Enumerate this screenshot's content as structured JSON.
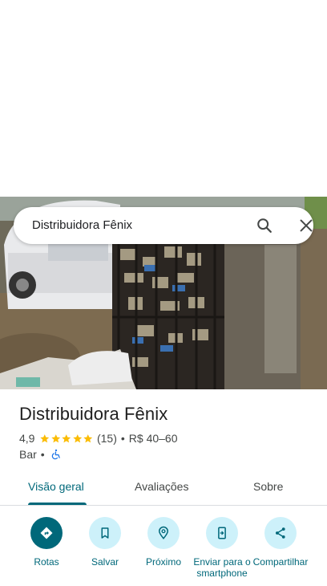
{
  "search": {
    "query": "Distribuidora Fênix"
  },
  "place": {
    "name": "Distribuidora Fênix",
    "rating": "4,9",
    "stars": 5,
    "review_count": "(15)",
    "price_range": "R$ 40–60",
    "category": "Bar",
    "separator": "•"
  },
  "tabs": [
    {
      "label": "Visão geral",
      "active": true
    },
    {
      "label": "Avaliações",
      "active": false
    },
    {
      "label": "Sobre",
      "active": false
    }
  ],
  "actions": [
    {
      "label": "Rotas",
      "icon": "directions-icon",
      "primary": true
    },
    {
      "label": "Salvar",
      "icon": "bookmark-icon",
      "primary": false
    },
    {
      "label": "Próximo",
      "icon": "nearby-icon",
      "primary": false
    },
    {
      "label": "Enviar para o smartphone",
      "icon": "send-to-phone-icon",
      "primary": false
    },
    {
      "label": "Compartilhar",
      "icon": "share-icon",
      "primary": false
    }
  ],
  "colors": {
    "accent": "#00687a",
    "action_bg": "#cdf1fa",
    "star": "#fbbc04"
  },
  "icons": {
    "search": "search-icon",
    "close": "close-icon",
    "accessibility": "wheelchair-icon"
  }
}
